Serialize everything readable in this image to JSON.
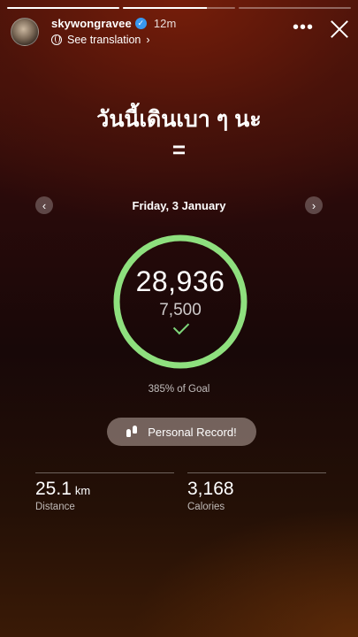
{
  "story": {
    "progress": [
      1,
      0.75,
      0
    ],
    "user": {
      "username": "skywongravee",
      "time": "12m",
      "translation_label": "See translation",
      "translation_chevron": "›"
    },
    "controls": {
      "more": "•••",
      "close_icon": "close-icon"
    },
    "caption": {
      "line1": "วันนี้เดินเบา ๆ นะ",
      "line2": "="
    }
  },
  "activity": {
    "date": "Friday, 3 January",
    "prev_glyph": "‹",
    "next_glyph": "›",
    "steps": "28,936",
    "goal": "7,500",
    "goal_met": true,
    "ring_progress": 1,
    "ring_color": "#8ee07e",
    "percent_label": "385% of Goal",
    "record_label": "Personal Record!",
    "stats": [
      {
        "value": "25.1",
        "unit": "km",
        "label": "Distance"
      },
      {
        "value": "3,168",
        "unit": "",
        "label": "Calories"
      }
    ]
  }
}
